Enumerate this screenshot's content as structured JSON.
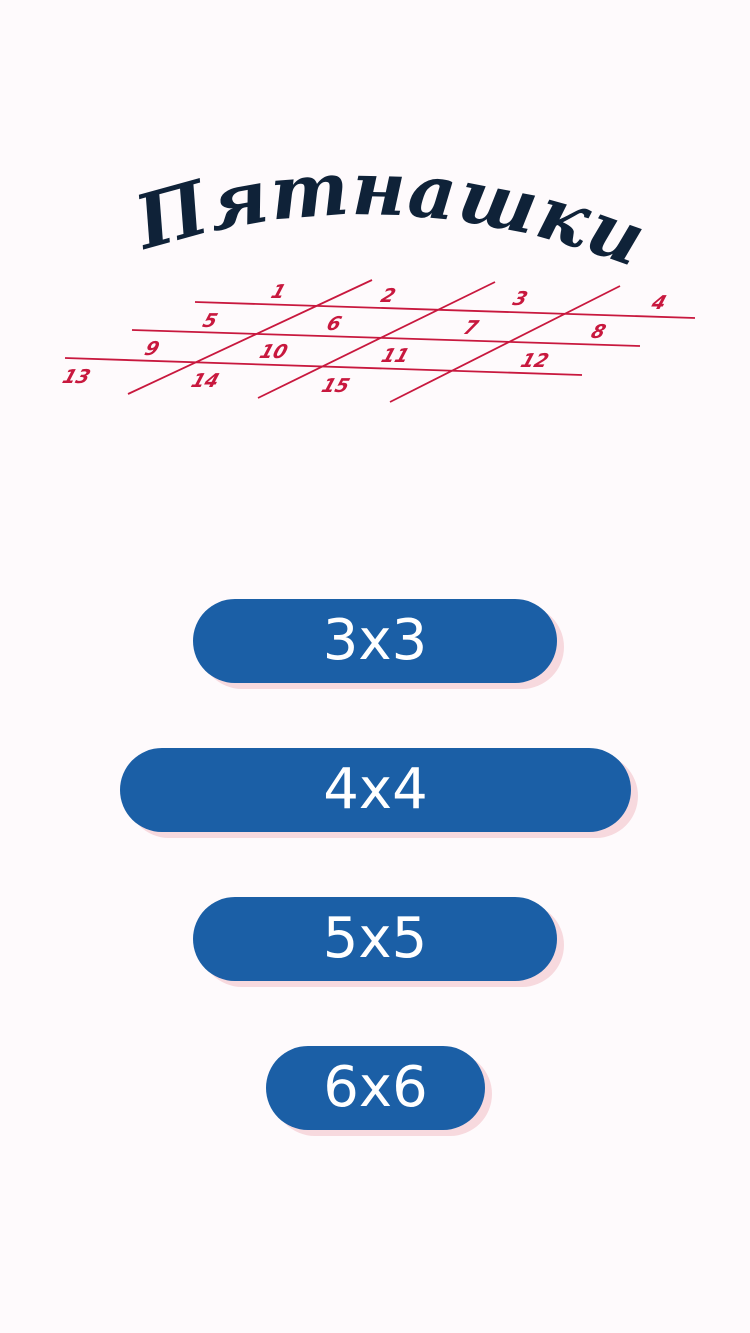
{
  "logo": {
    "title": "Пятнашки",
    "tiles": [
      "1",
      "2",
      "3",
      "4",
      "5",
      "6",
      "7",
      "8",
      "9",
      "10",
      "11",
      "12",
      "13",
      "14",
      "15"
    ],
    "title_color": "#0f2238",
    "grid_color": "#c8183e"
  },
  "menu": {
    "buttons": [
      {
        "label": "3x3"
      },
      {
        "label": "4x4"
      },
      {
        "label": "5x5"
      },
      {
        "label": "6x6"
      }
    ],
    "button_color": "#1b5fa6",
    "button_text_color": "#ffffff",
    "shadow_color": "#f7d9de"
  }
}
